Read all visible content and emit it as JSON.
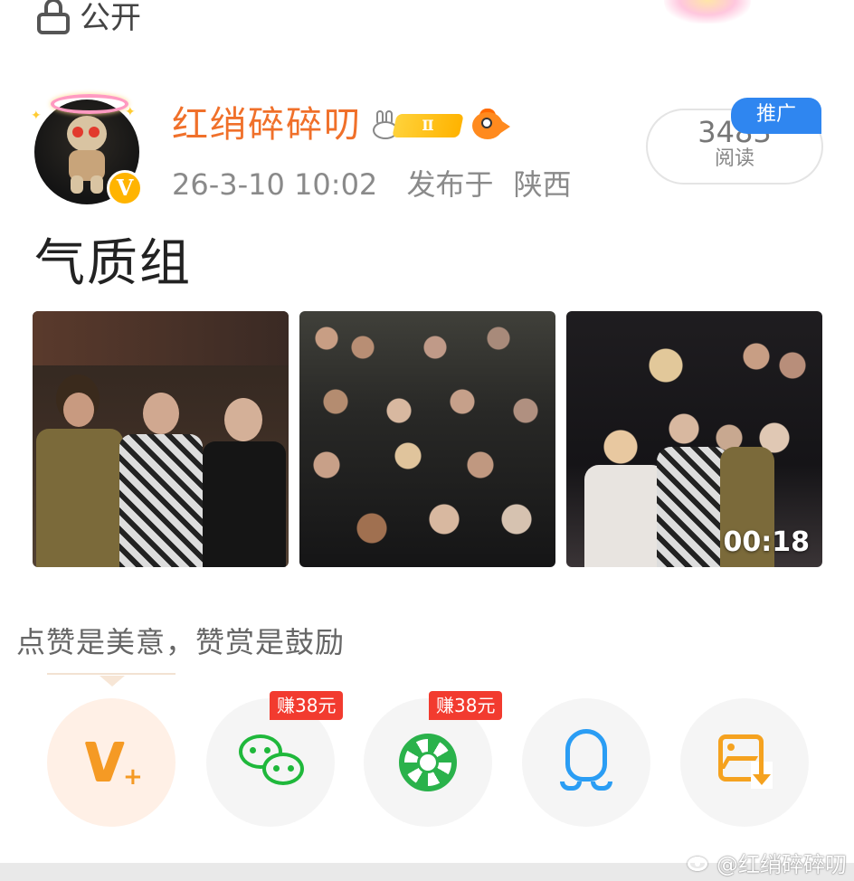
{
  "top": {
    "visibility_label": "公开"
  },
  "post": {
    "author": "红绡碎碎叨",
    "rank_badge": "Ⅱ",
    "date": "26-3-10 10:02",
    "location_prefix": "发布于",
    "location": "陕西",
    "reads_count": "3483",
    "reads_label": "阅读",
    "promo_label": "推广",
    "title": "气质组",
    "verified_badge": "V",
    "video_duration": "00:18"
  },
  "reward": {
    "prompt": "点赞是美意，赞赏是鼓励"
  },
  "share": {
    "buttons": [
      {
        "icon": "weibo-v-plus-icon"
      },
      {
        "icon": "wechat-icon",
        "earn_label": "赚38元"
      },
      {
        "icon": "wechat-moments-icon",
        "earn_label": "赚38元"
      },
      {
        "icon": "qq-icon"
      },
      {
        "icon": "save-image-icon"
      }
    ]
  },
  "watermark": {
    "text": "@红绡碎碎叨"
  },
  "colors": {
    "author": "#f0702a",
    "promo": "#2f86f0",
    "earn": "#f23b2f",
    "wechat": "#1fb83b",
    "qq": "#2a9df4",
    "save": "#f5a21f"
  }
}
